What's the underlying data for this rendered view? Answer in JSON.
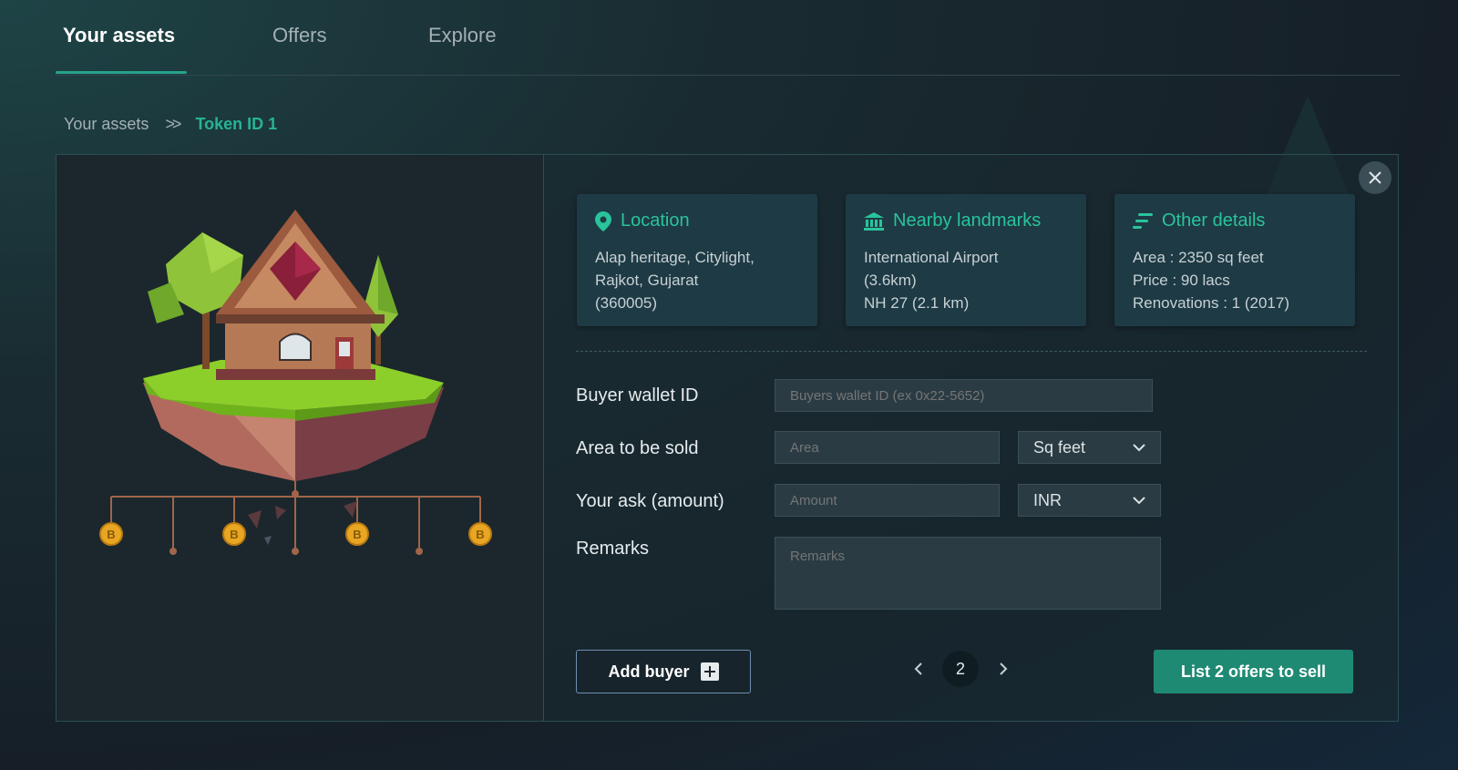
{
  "tabs": [
    {
      "label": "Your assets"
    },
    {
      "label": "Offers"
    },
    {
      "label": "Explore"
    }
  ],
  "breadcrumb": {
    "root": "Your assets",
    "separator": ">>",
    "current": "Token ID 1"
  },
  "info_cards": {
    "location": {
      "title": "Location",
      "icon": "map-pin-icon",
      "lines": [
        "Alap heritage, Citylight,",
        "Rajkot, Gujarat",
        "(360005)"
      ]
    },
    "landmarks": {
      "title": "Nearby landmarks",
      "icon": "bank-icon",
      "lines": [
        "International Airport",
        "(3.6km)",
        "NH 27 (2.1 km)"
      ]
    },
    "details": {
      "title": "Other details",
      "icon": "list-icon",
      "lines": [
        "Area : 2350 sq feet",
        "Price : 90 lacs",
        "Renovations : 1 (2017)"
      ]
    }
  },
  "form": {
    "buyer_wallet": {
      "label": "Buyer wallet ID",
      "placeholder": "Buyers wallet ID (ex 0x22-5652)",
      "value": ""
    },
    "area": {
      "label": "Area to be sold",
      "placeholder": "Area",
      "value": "",
      "unit": "Sq feet"
    },
    "ask": {
      "label": "Your ask (amount)",
      "placeholder": "Amount",
      "value": "",
      "currency": "INR"
    },
    "remarks": {
      "label": "Remarks",
      "placeholder": "Remarks",
      "value": ""
    }
  },
  "actions": {
    "add_buyer": "Add buyer",
    "list_offers": "List 2 offers to sell"
  },
  "pagination": {
    "current": "2"
  },
  "colors": {
    "accent": "#27b394",
    "button": "#1f8a73",
    "card": "#1e3a45"
  }
}
